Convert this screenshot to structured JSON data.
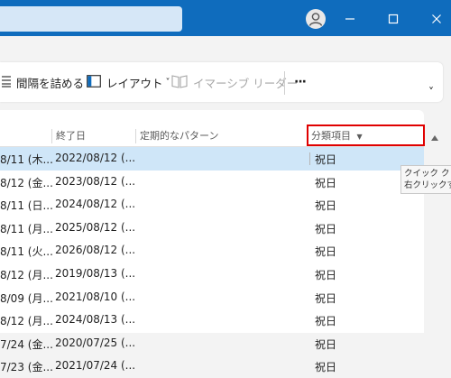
{
  "window": {
    "minimize_glyph": "—",
    "maximize_glyph": "☐",
    "close_glyph": "✕"
  },
  "ribbon": {
    "compact_label": "間隔を詰める",
    "layout_label": "レイアウト",
    "layout_chevron": "˅",
    "immersive_label": "イマーシブ リーダー",
    "more_label": "···",
    "expand_label": "˅"
  },
  "table": {
    "headers": {
      "start": "",
      "end": "終了日",
      "pattern": "定期的なパターン",
      "category": "分類項目"
    },
    "rows": [
      {
        "start": "8/11 (木...",
        "end": "2022/08/12 (...",
        "category": "祝日"
      },
      {
        "start": "8/12 (金...",
        "end": "2023/08/12 (...",
        "category": "祝日"
      },
      {
        "start": "8/11 (日...",
        "end": "2024/08/12 (...",
        "category": "祝日"
      },
      {
        "start": "8/11 (月...",
        "end": "2025/08/12 (...",
        "category": "祝日"
      },
      {
        "start": "8/11 (火...",
        "end": "2026/08/12 (...",
        "category": "祝日"
      },
      {
        "start": "8/12 (月...",
        "end": "2019/08/13 (...",
        "category": "祝日"
      },
      {
        "start": "8/09 (月...",
        "end": "2021/08/10 (...",
        "category": "祝日"
      },
      {
        "start": "8/12 (月...",
        "end": "2024/08/13 (...",
        "category": "祝日"
      },
      {
        "start": "7/24 (金...",
        "end": "2020/07/25 (...",
        "category": "祝日"
      },
      {
        "start": "7/23 (金...",
        "end": "2021/07/24 (...",
        "category": "祝日"
      }
    ]
  },
  "tooltip": {
    "line1": "クイック クリッ",
    "line2": "右クリックする"
  },
  "colors": {
    "titlebar": "#0f6cbd",
    "selected_row": "#cfe6f8",
    "highlight": "#e00000"
  }
}
